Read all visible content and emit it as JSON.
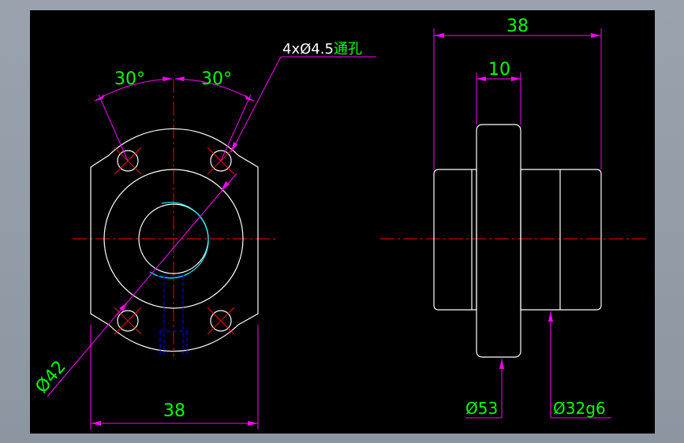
{
  "colors": {
    "background": "#000000",
    "outline": "#ffffff",
    "dimension": "#ff00ff",
    "dim_text": "#00ff00",
    "centerline": "#ff0000",
    "hidden_line": "#0000ff",
    "thread_arc": "#00ffff",
    "frame": "#8c96a1"
  },
  "front_view": {
    "angle_left": "30°",
    "angle_right": "30°",
    "hole_callout_prefix": "4xØ4.5",
    "hole_callout_suffix": "通孔",
    "diameter_pcd": "Ø42",
    "width_bottom": "38"
  },
  "side_view": {
    "overall_width": "38",
    "flange_width": "10",
    "flange_diameter": "Ø53",
    "body_diameter": "Ø32g6"
  }
}
